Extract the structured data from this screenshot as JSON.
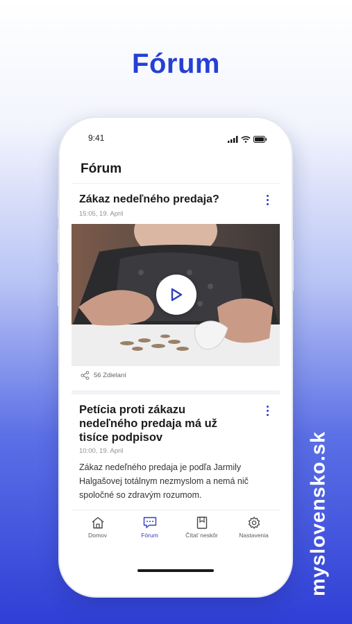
{
  "promo": {
    "headline": "Fórum",
    "brand": "myslovensko.sk"
  },
  "status_bar": {
    "time": "9:41"
  },
  "app": {
    "title": "Fórum"
  },
  "posts": [
    {
      "title": "Zákaz nedeľného predaja?",
      "date": "15:05, 19. April",
      "shares": "56 Zdielaní",
      "media": "video"
    },
    {
      "title": "Petícia proti zákazu nedeľného predaja má už tisíce podpisov",
      "date": "10:00, 19. April",
      "excerpt": "Zákaz nedeľného predaja je podľa Jarmily Halgašovej totálnym nezmyslom a nemá nič spoločné so zdravým rozumom."
    }
  ],
  "tabs": [
    {
      "label": "Domov",
      "icon": "home-icon",
      "active": false
    },
    {
      "label": "Fórum",
      "icon": "forum-icon",
      "active": true
    },
    {
      "label": "Čítať neskôr",
      "icon": "bookmark-icon",
      "active": false
    },
    {
      "label": "Nastavenia",
      "icon": "gear-icon",
      "active": false
    }
  ],
  "colors": {
    "accent": "#2f3fbf",
    "headline": "#2640d4"
  }
}
